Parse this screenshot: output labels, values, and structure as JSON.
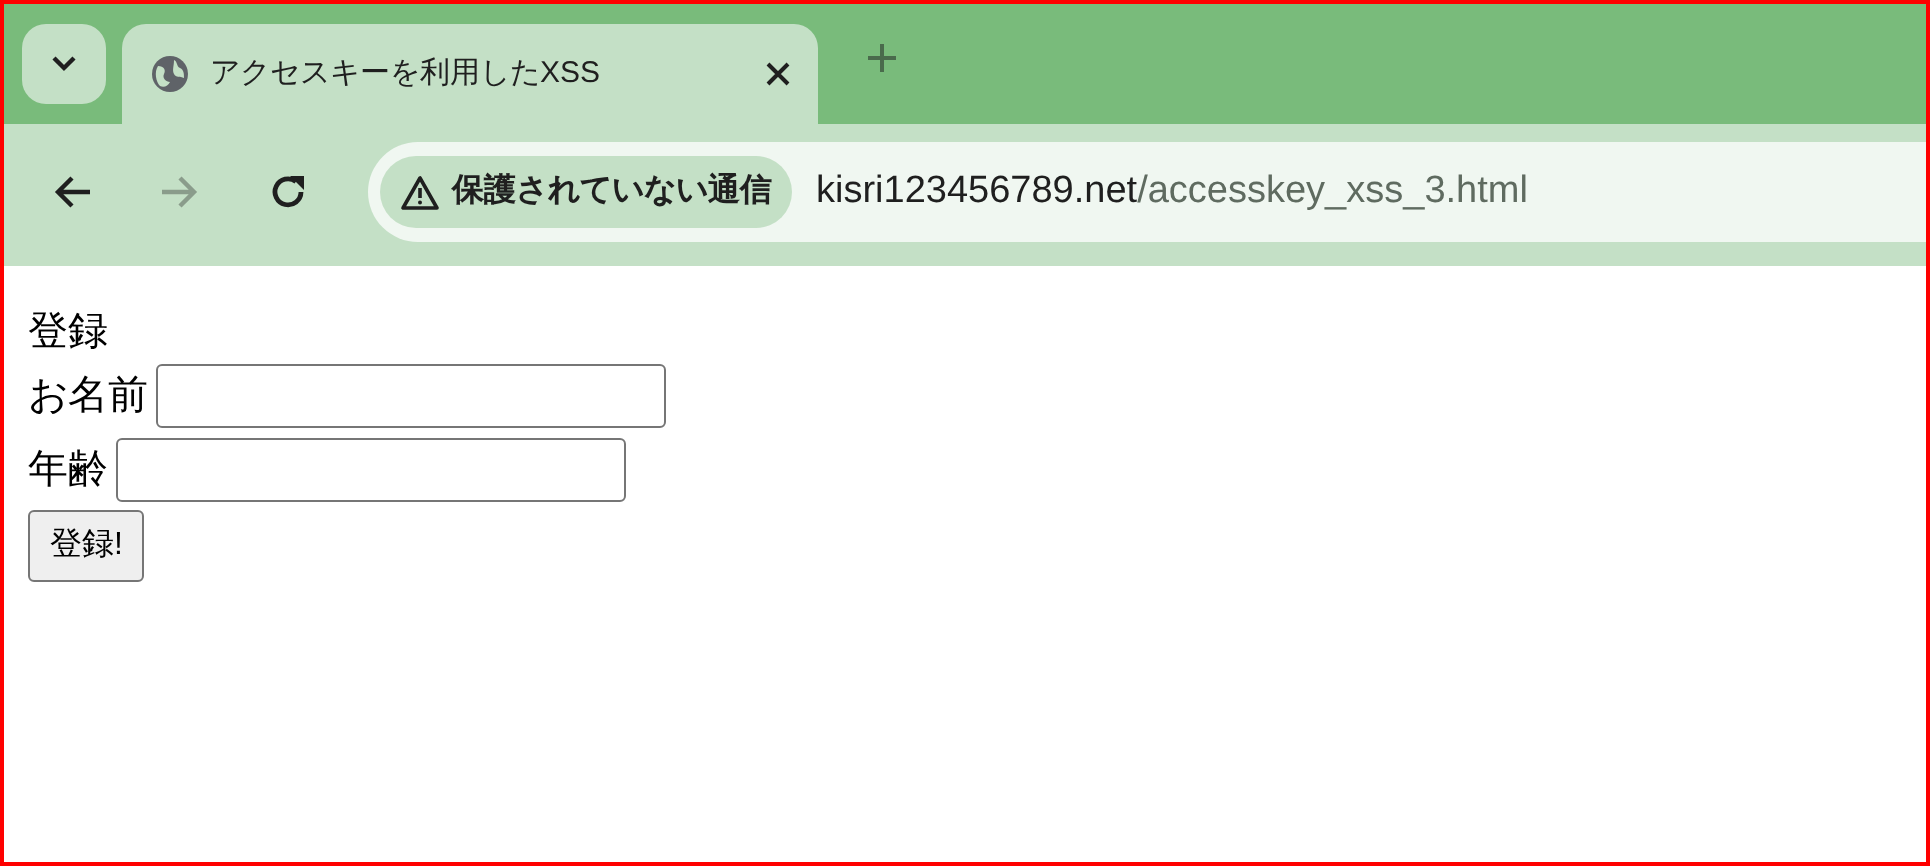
{
  "tab": {
    "title": "アクセスキーを利用したXSS",
    "selected": true
  },
  "toolbar": {
    "forward_disabled": true,
    "security_label": "保護されていない通信",
    "url_host": "kisri123456789.net",
    "url_path": "/accesskey_xss_3.html"
  },
  "page": {
    "heading": "登録",
    "fields": [
      {
        "label": "お名前"
      },
      {
        "label": "年齢"
      }
    ],
    "submit": "登録!"
  }
}
